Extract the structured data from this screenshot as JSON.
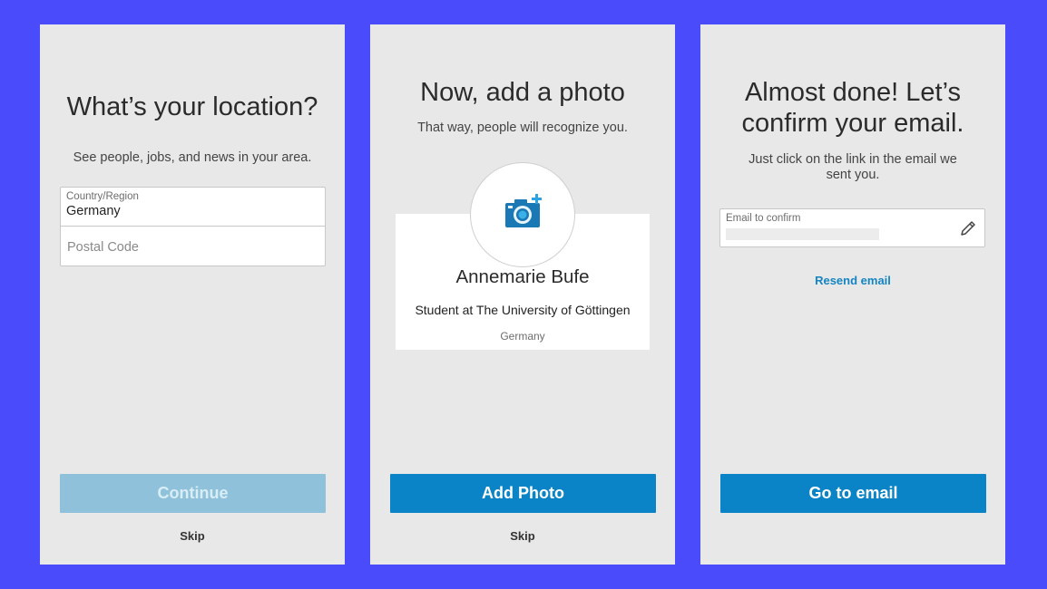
{
  "screens": {
    "location": {
      "heading": "What’s your location?",
      "subtext": "See people, jobs, and news in your area.",
      "country_label": "Country/Region",
      "country_value": "Germany",
      "postal_placeholder": "Postal Code",
      "continue_label": "Continue",
      "skip_label": "Skip"
    },
    "photo": {
      "heading": "Now, add a photo",
      "subtext": "That way, people will recognize you.",
      "profile_name": "Annemarie Bufe",
      "profile_headline": "Student at The University of Göttingen",
      "profile_location": "Germany",
      "add_photo_label": "Add Photo",
      "skip_label": "Skip",
      "photo_icon": "camera-add-icon"
    },
    "email": {
      "heading_line1": "Almost done! Let’s",
      "heading_line2": "confirm your email.",
      "subtext": "Just click on the link in the email we sent you.",
      "email_label": "Email to confirm",
      "edit_icon": "pencil-icon",
      "resend_label": "Resend email",
      "go_label": "Go to email"
    }
  },
  "colors": {
    "background": "#4a4bfa",
    "screen": "#e8e8e8",
    "primary": "#0a84c6",
    "primary_disabled": "#8fc2da",
    "link": "#1585c2"
  }
}
